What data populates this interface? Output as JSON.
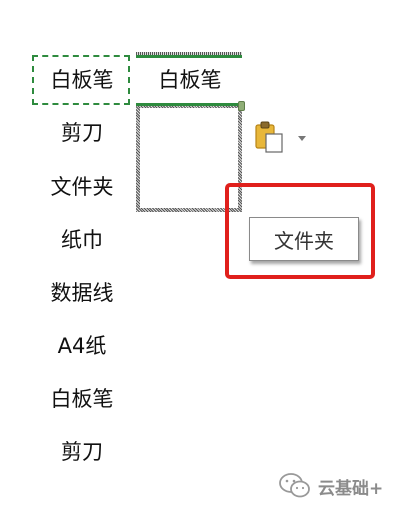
{
  "sheet": {
    "column_a": [
      "白板笔",
      "剪刀",
      "文件夹",
      "纸巾",
      "数据线",
      "A4纸",
      "白板笔",
      "剪刀"
    ],
    "selected_cell_value": "白板笔",
    "copy_border_color": "#2e8b3e",
    "selection_color": "#2e8b3e"
  },
  "paste_button": {
    "icon": "paste-clipboard-icon",
    "dropdown_icon": "caret-down-icon"
  },
  "tooltip": {
    "text": "文件夹"
  },
  "highlight": {
    "color": "#e0201c"
  },
  "watermark": {
    "logo": "wechat-logo",
    "text": "云基础+"
  }
}
